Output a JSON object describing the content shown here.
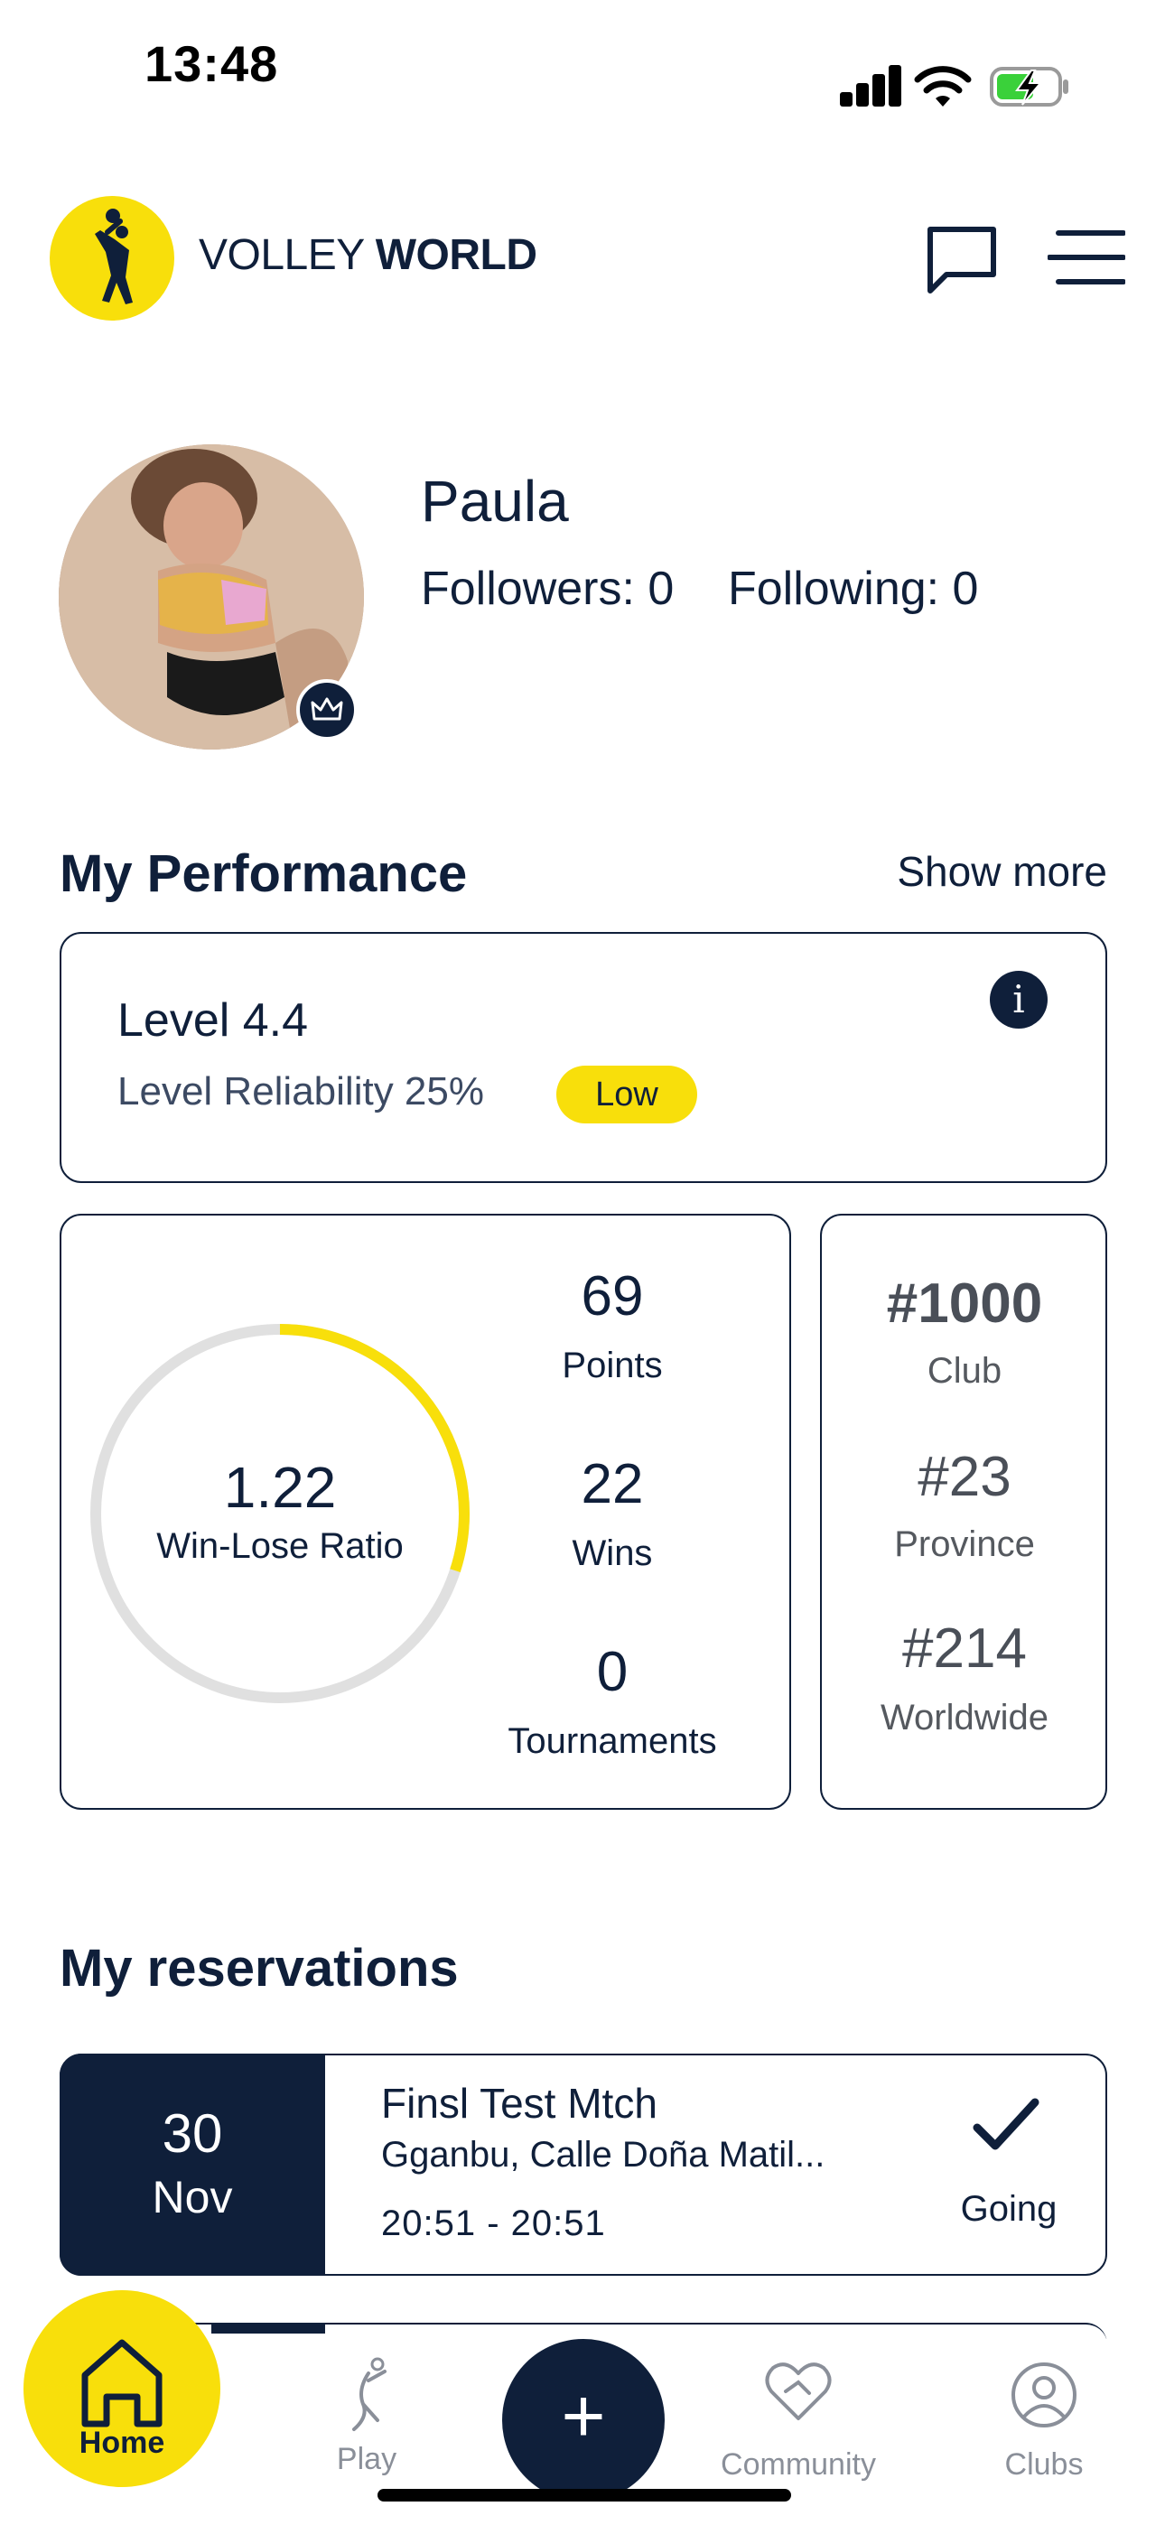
{
  "status_bar": {
    "time": "13:48"
  },
  "header": {
    "brand_light": "VOLLEY ",
    "brand_bold": "WORLD"
  },
  "profile": {
    "name": "Paula",
    "followers": "Followers: 0",
    "following": "Following: 0"
  },
  "performance": {
    "title": "My Performance",
    "show_more": "Show more",
    "level": "Level 4.4",
    "reliability": "Level Reliability 25%",
    "reliability_badge": "Low",
    "info_glyph": "i",
    "win_lose_ratio": "1.22",
    "win_lose_label": "Win-Lose Ratio",
    "ratio_ring_fraction": 0.3,
    "stats": [
      {
        "value": "69",
        "label": "Points"
      },
      {
        "value": "22",
        "label": "Wins"
      },
      {
        "value": "0",
        "label": "Tournaments"
      }
    ],
    "ranks": [
      {
        "value": "#1000",
        "label": "Club"
      },
      {
        "value": "#23",
        "label": "Province"
      },
      {
        "value": "#214",
        "label": "Worldwide"
      }
    ]
  },
  "reservations": {
    "title": "My reservations",
    "items": [
      {
        "day": "30",
        "month": "Nov",
        "title": "Finsl Test Mtch",
        "place": "Gganbu, Calle Doña Matil...",
        "time": "20:51 - 20:51",
        "status": "Going"
      }
    ]
  },
  "nav": {
    "home": "Home",
    "play": "Play",
    "add": "+",
    "community": "Community",
    "clubs": "Clubs"
  },
  "colors": {
    "brand_yellow": "#f8df0b",
    "navy": "#0f1f3a",
    "ring_gray": "#e0e0e0"
  },
  "icons": [
    "signal-icon",
    "wifi-icon",
    "battery-charging-icon",
    "volleyball-player-logo",
    "chat-icon",
    "menu-icon",
    "crown-icon",
    "info-icon",
    "check-icon",
    "home-icon",
    "play-icon",
    "plus-icon",
    "community-heart-icon",
    "clubs-user-icon"
  ]
}
